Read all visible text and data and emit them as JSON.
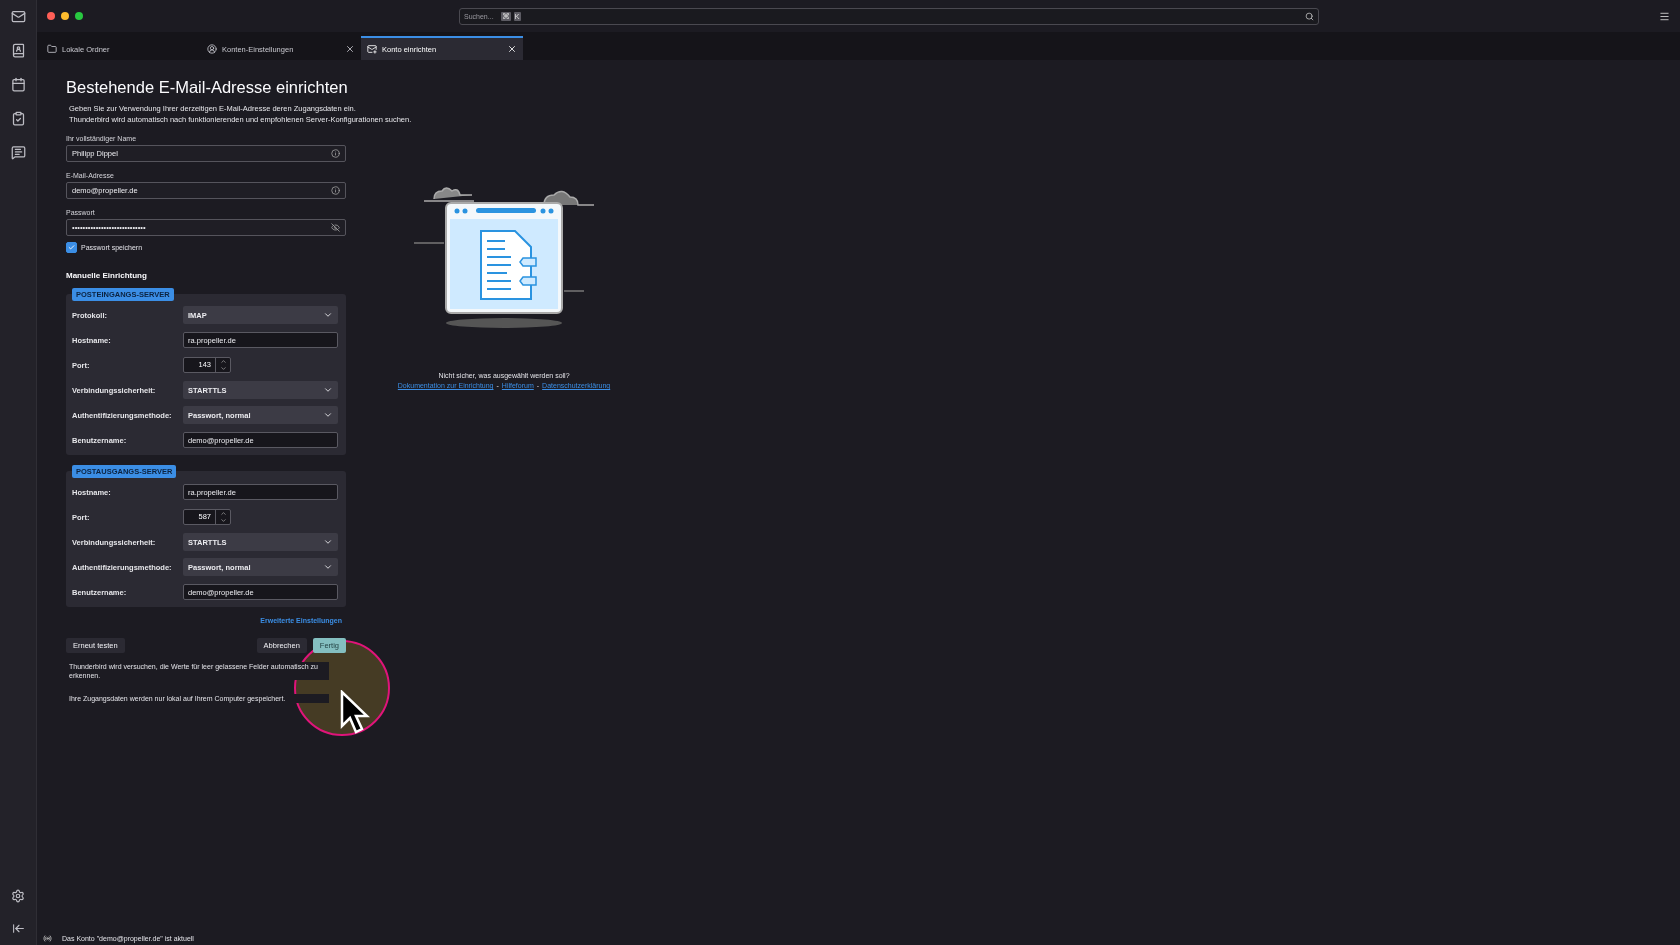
{
  "search": {
    "placeholder": "Suchen...",
    "keys": [
      "⌘",
      "K"
    ]
  },
  "tabs": [
    {
      "label": "Lokale Ordner",
      "closable": false,
      "selected": false
    },
    {
      "label": "Konten-Einstellungen",
      "closable": true,
      "selected": false
    },
    {
      "label": "Konto einrichten",
      "closable": true,
      "selected": true
    }
  ],
  "title": "Bestehende E-Mail-Adresse einrichten",
  "intro": [
    "Geben Sie zur Verwendung Ihrer derzeitigen E-Mail-Adresse deren Zugangsdaten ein.",
    "Thunderbird wird automatisch nach funktionierenden und empfohlenen Server-Konfigurationen suchen."
  ],
  "fields": [
    {
      "label": "Ihr vollständiger Name",
      "value": "Philipp Dippel",
      "kind": "info"
    },
    {
      "label": "E-Mail-Adresse",
      "value": "demo@propeller.de",
      "kind": "info"
    },
    {
      "label": "Passwort",
      "value": "••••••••••••••••••••••••••••",
      "kind": "password"
    }
  ],
  "save_password": {
    "label": "Passwort speichern",
    "checked": true
  },
  "manual_heading": "Manuelle Einrichtung",
  "servers": [
    {
      "badge": "POSTEINGANGS-SERVER",
      "rows": [
        {
          "label": "Protokoll:",
          "kind": "select",
          "value": "IMAP"
        },
        {
          "label": "Hostname:",
          "kind": "text",
          "value": "ra.propeller.de"
        },
        {
          "label": "Port:",
          "kind": "spinner",
          "value": "143"
        },
        {
          "label": "Verbindungssicherheit:",
          "kind": "select",
          "value": "STARTTLS"
        },
        {
          "label": "Authentifizierungsmethode:",
          "kind": "select",
          "value": "Passwort, normal"
        },
        {
          "label": "Benutzername:",
          "kind": "text",
          "value": "demo@propeller.de"
        }
      ]
    },
    {
      "badge": "POSTAUSGANGS-SERVER",
      "rows": [
        {
          "label": "Hostname:",
          "kind": "text",
          "value": "ra.propeller.de"
        },
        {
          "label": "Port:",
          "kind": "spinner",
          "value": "587"
        },
        {
          "label": "Verbindungssicherheit:",
          "kind": "select",
          "value": "STARTTLS"
        },
        {
          "label": "Authentifizierungsmethode:",
          "kind": "select",
          "value": "Passwort, normal"
        },
        {
          "label": "Benutzername:",
          "kind": "text",
          "value": "demo@propeller.de"
        }
      ]
    }
  ],
  "advanced_link": "Erweiterte Einstellungen",
  "buttons": [
    {
      "label": "Erneut testen",
      "kind": "secondary"
    },
    {
      "label": "Abbrechen",
      "kind": "secondary"
    },
    {
      "label": "Fertig",
      "kind": "primary"
    }
  ],
  "notes": [
    "Thunderbird wird versuchen, die Werte für leer gelassene Felder automatisch zu erkennen.",
    "Ihre Zugangsdaten werden nur lokal auf Ihrem Computer gespeichert."
  ],
  "help": {
    "question": "Nicht sicher, was ausgewählt werden soll?",
    "separator": "-",
    "links": [
      "Dokumentation zur Einrichtung",
      "Hilfeforum",
      "Datenschutzerklärung"
    ]
  },
  "status_bar": "Das Konto \"demo@propeller.de\" ist aktuell"
}
